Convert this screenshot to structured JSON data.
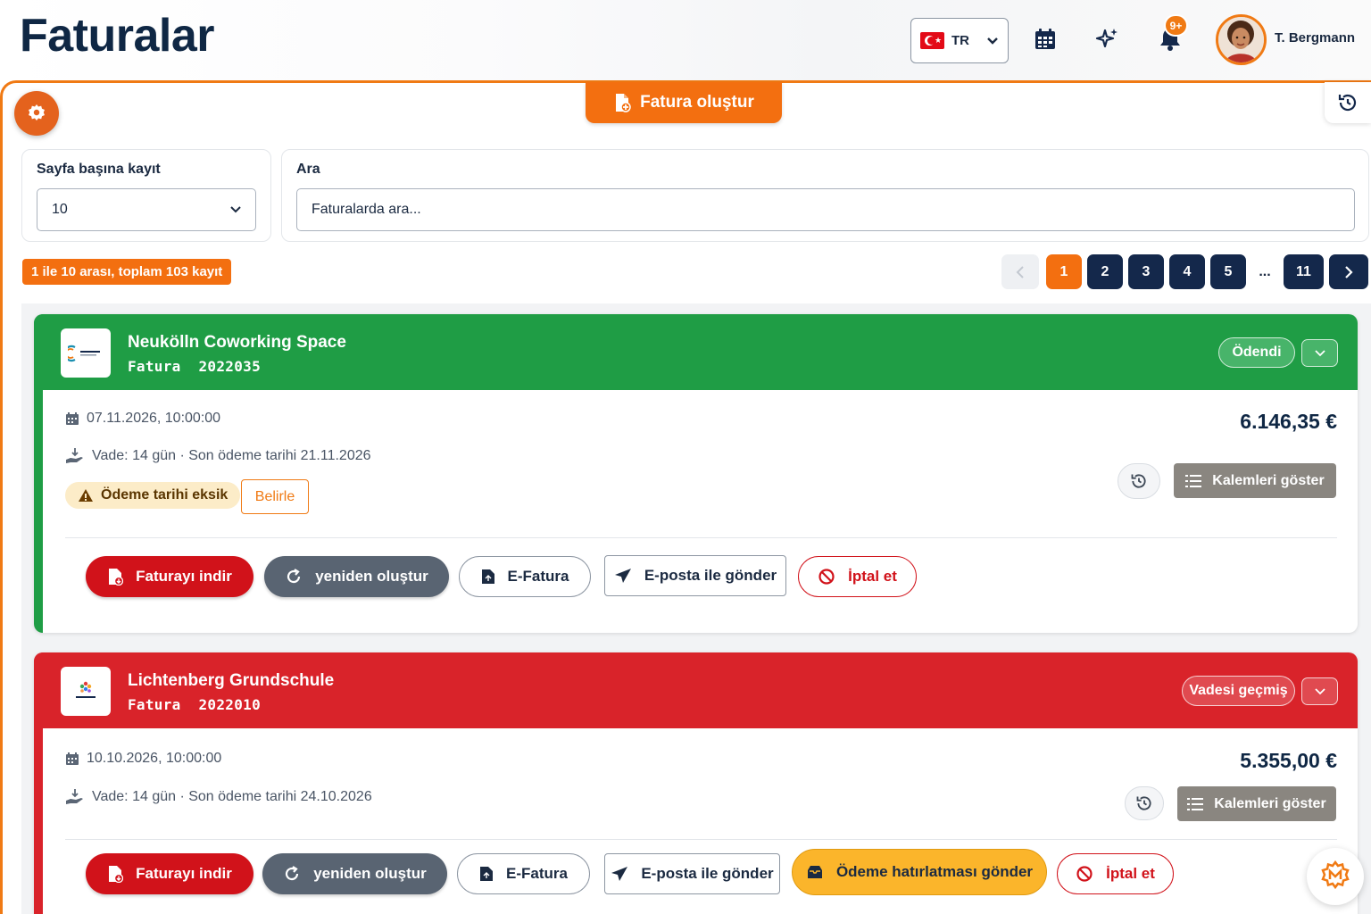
{
  "header": {
    "title": "Faturalar",
    "language": {
      "code": "TR",
      "flag": "turkey-flag"
    },
    "notifications_badge": "9+",
    "user_name": "T. Bergmann",
    "icons": [
      "calendar-icon",
      "sparkle-icon",
      "bell-icon"
    ]
  },
  "toolbar": {
    "create_invoice_label": "Fatura oluştur"
  },
  "filters": {
    "per_page_label": "Sayfa başına kayıt",
    "per_page_value": "10",
    "search_label": "Ara",
    "search_placeholder": "Faturalarda ara..."
  },
  "results_summary": "1 ile 10 arası, toplam 103 kayıt",
  "pagination": {
    "current": "1",
    "pages": [
      "1",
      "2",
      "3",
      "4",
      "5"
    ],
    "ellipsis": "...",
    "last": "11"
  },
  "invoices": [
    {
      "customer": "Neukölln Coworking Space",
      "invoice_label": "Fatura",
      "invoice_number": "2022035",
      "status": "Ödendi",
      "status_color": "#1f9d45",
      "date": "07.11.2026, 10:00:00",
      "terms": "Vade: 14 gün · Son ödeme tarihi 21.11.2026",
      "amount": "6.146,35 €",
      "warning": "Ödeme tarihi eksik",
      "set_label": "Belirle",
      "items_label": "Kalemleri göster",
      "actions": {
        "download": "Faturayı indir",
        "regenerate": "yeniden oluştur",
        "einvoice": "E-Fatura",
        "email": "E-posta ile gönder",
        "cancel": "İptal et"
      }
    },
    {
      "customer": "Lichtenberg Grundschule",
      "invoice_label": "Fatura",
      "invoice_number": "2022010",
      "status": "Vadesi geçmiş",
      "status_color": "#d9232a",
      "date": "10.10.2026, 10:00:00",
      "terms": "Vade: 14 gün · Son ödeme tarihi 24.10.2026",
      "amount": "5.355,00 €",
      "items_label": "Kalemleri göster",
      "actions": {
        "download": "Faturayı indir",
        "regenerate": "yeniden oluştur",
        "einvoice": "E-Fatura",
        "email": "E-posta ile gönder",
        "reminder": "Ödeme hatırlatması gönder",
        "cancel": "İptal et"
      }
    }
  ],
  "colors": {
    "accent": "#f36f10",
    "navy": "#14284b",
    "paid": "#1f9d45",
    "overdue": "#d9232a"
  }
}
